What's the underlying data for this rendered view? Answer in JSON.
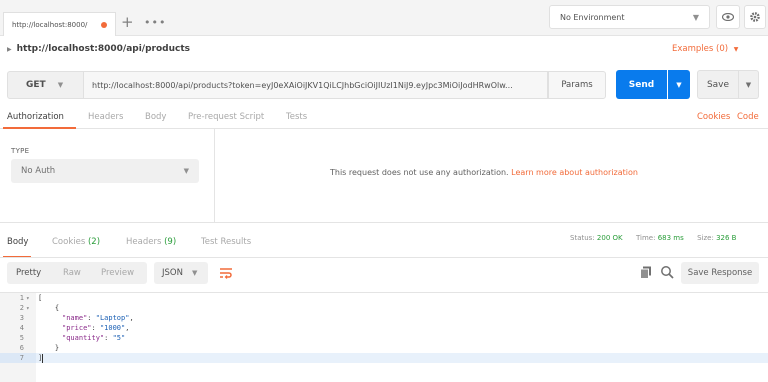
{
  "tabstrip": {
    "tab_title": "http://localhost:8000/",
    "add_tab": "+",
    "more_tabs": "•••",
    "environment": "No Environment"
  },
  "request": {
    "name": "http://localhost:8000/api/products",
    "examples": "Examples (0)",
    "method": "GET",
    "url": "http://localhost:8000/api/products?token=eyJ0eXAiOiJKV1QiLCJhbGciOiJIUzI1NiJ9.eyJpc3MiOiJodHRwOlw...",
    "params_label": "Params",
    "send_label": "Send",
    "save_label": "Save"
  },
  "request_tabs": {
    "authorization": "Authorization",
    "headers": "Headers",
    "body": "Body",
    "prerequest": "Pre-request Script",
    "tests": "Tests",
    "cookies": "Cookies",
    "code": "Code"
  },
  "auth": {
    "type_label": "TYPE",
    "type_value": "No Auth",
    "message": "This request does not use any authorization.",
    "learn_more": "Learn more about authorization"
  },
  "response_tabs": {
    "body": "Body",
    "cookies": "Cookies",
    "cookies_count": "(2)",
    "headers": "Headers",
    "headers_count": "(9)",
    "test_results": "Test Results"
  },
  "status": {
    "status_label": "Status:",
    "status_value": "200 OK",
    "time_label": "Time:",
    "time_value": "683 ms",
    "size_label": "Size:",
    "size_value": "326 B"
  },
  "body_toolbar": {
    "pretty": "Pretty",
    "raw": "Raw",
    "preview": "Preview",
    "format": "JSON",
    "save_response": "Save Response"
  },
  "editor": {
    "line_numbers": [
      "1",
      "2",
      "3",
      "4",
      "5",
      "6",
      "7"
    ],
    "code": {
      "l1": "[",
      "l2": "    {",
      "l3_key": "\"name\"",
      "l3_val": "\"Laptop\"",
      "l4_key": "\"price\"",
      "l4_val": "\"1000\"",
      "l5_key": "\"quantity\"",
      "l5_val": "\"5\"",
      "l6": "    }",
      "l7": "]"
    }
  },
  "colors": {
    "accent": "#f26b3a",
    "send_blue": "#097bed",
    "status_green": "#2a9d3a"
  }
}
